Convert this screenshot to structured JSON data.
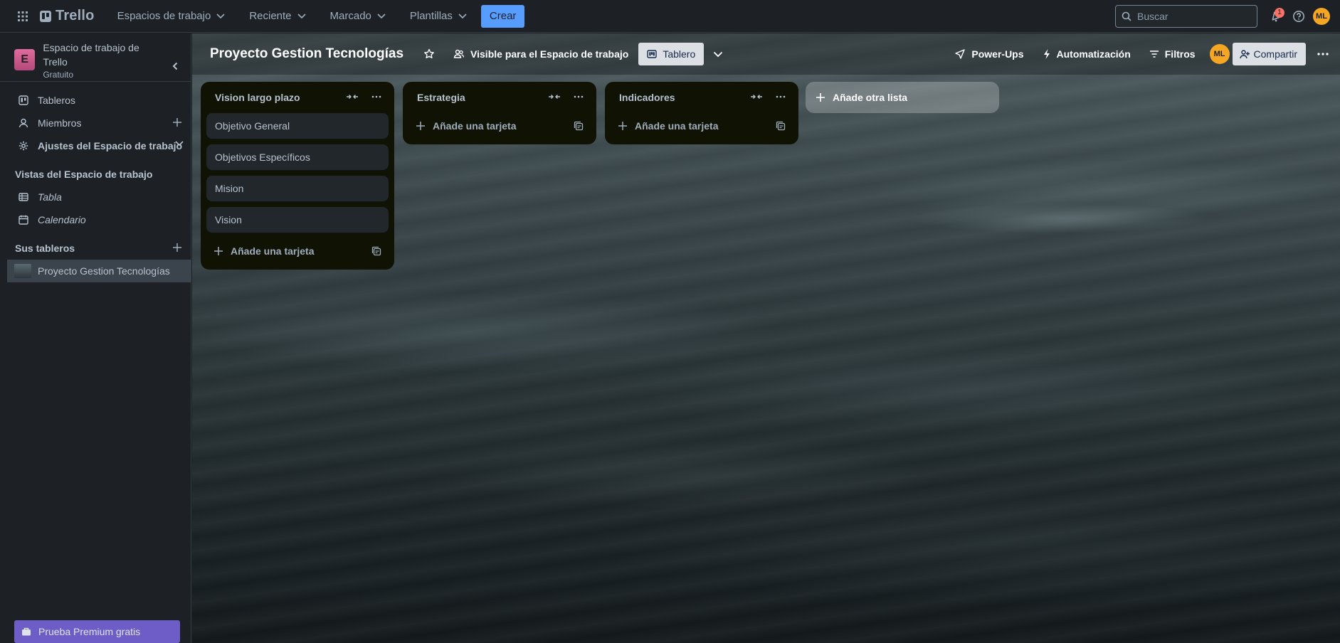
{
  "topbar": {
    "app_name": "Trello",
    "nav": [
      {
        "label": "Espacios de trabajo"
      },
      {
        "label": "Reciente"
      },
      {
        "label": "Marcado"
      },
      {
        "label": "Plantillas"
      }
    ],
    "create_label": "Crear",
    "search_placeholder": "Buscar",
    "notification_count": "1",
    "user_initials": "ML"
  },
  "sidebar": {
    "workspace_initial": "E",
    "workspace_name": "Espacio de trabajo de Trello",
    "workspace_plan": "Gratuito",
    "items": [
      {
        "label": "Tableros"
      },
      {
        "label": "Miembros"
      },
      {
        "label": "Ajustes del Espacio de trabajo"
      }
    ],
    "views_title": "Vistas del Espacio de trabajo",
    "views": [
      {
        "label": "Tabla"
      },
      {
        "label": "Calendario"
      }
    ],
    "boards_title": "Sus tableros",
    "boards": [
      {
        "label": "Proyecto Gestion Tecnologías"
      }
    ],
    "premium_label": "Prueba Premium gratis"
  },
  "board": {
    "title": "Proyecto Gestion Tecnologías",
    "visibility_label": "Visible para el Espacio de trabajo",
    "view_label": "Tablero",
    "powerups_label": "Power-Ups",
    "automation_label": "Automatización",
    "filters_label": "Filtros",
    "member_initials": "ML",
    "share_label": "Compartir",
    "add_card_label": "Añade una tarjeta",
    "add_list_label": "Añade otra lista",
    "lists": [
      {
        "title": "Vision largo plazo",
        "cards": [
          "Objetivo General",
          "Objetivos Específicos",
          "Mision",
          "Vision"
        ]
      },
      {
        "title": "Estrategia",
        "cards": []
      },
      {
        "title": "Indicadores",
        "cards": []
      }
    ]
  },
  "colors": {
    "accent": "#579dff",
    "badge": "#f87168",
    "avatar": "#f5a623",
    "premium": "#6e5dc6"
  }
}
